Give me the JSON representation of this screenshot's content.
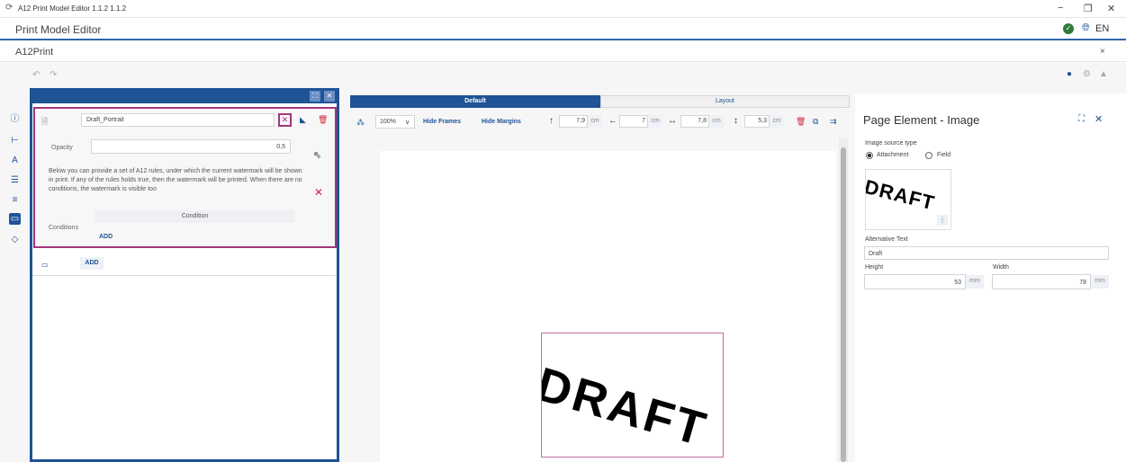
{
  "window": {
    "title": "A12 Print Model Editor 1.1.2 1.1.2",
    "minimize": "−",
    "restore": "❐",
    "close": "✕"
  },
  "appbar": {
    "title": "Print Model Editor",
    "language": "EN"
  },
  "tab": {
    "title": "A12Print",
    "close": "×"
  },
  "toolbar": {
    "undo": "↶",
    "redo": "↷"
  },
  "watermark": {
    "name_value": "Draft_Portrait",
    "opacity_label": "Opacity",
    "opacity_value": "0,5",
    "description": "Below you can provide a set of A12 rules, under which the current watermark will be shown in print. If any of the rules holds true, then the watermark will be printed. When there are no conditions, the watermark is visible too",
    "condition_header": "Condition",
    "conditions_label": "Conditions",
    "add_condition": "ADD",
    "add_watermark": "ADD"
  },
  "canvas": {
    "tabs": [
      "Default",
      "Layout"
    ],
    "zoom": "100%",
    "hide_frames": "Hide Frames",
    "hide_margins": "Hide Margins",
    "top_value": "7,9",
    "left_value": "7",
    "width_value": "7,8",
    "height_value": "5,3",
    "unit": "cm",
    "image_text": "DRAFT"
  },
  "properties": {
    "title": "Page Element - Image",
    "source_type_label": "Image source type",
    "option_attachment": "Attachment",
    "option_field": "Field",
    "thumb_text": "DRAFT",
    "alt_text_label": "Alternative Text",
    "alt_text_value": "Draft",
    "height_label": "Height",
    "height_value": "53",
    "width_label": "Width",
    "width_value": "78",
    "unit": "mm"
  },
  "colors": {
    "accent": "#1e5396",
    "selection": "#a3357a",
    "danger": "#d0243a",
    "success": "#2d7a3a"
  }
}
